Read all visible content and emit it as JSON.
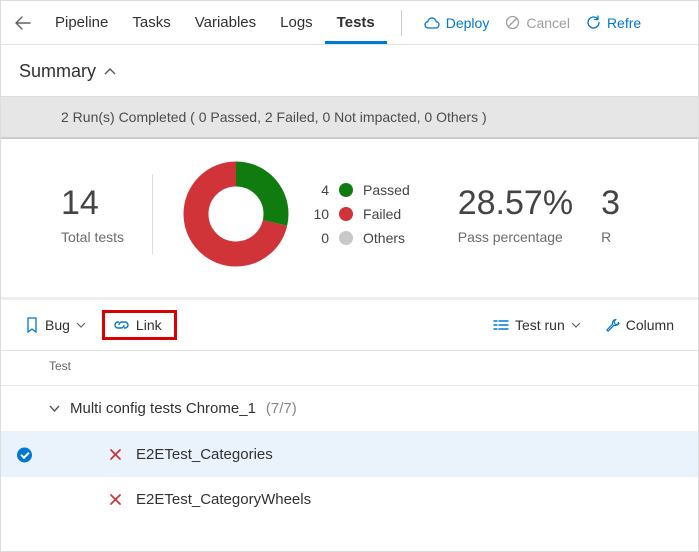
{
  "tabs": {
    "pipeline": "Pipeline",
    "tasks": "Tasks",
    "variables": "Variables",
    "logs": "Logs",
    "tests": "Tests"
  },
  "actions": {
    "deploy": "Deploy",
    "cancel": "Cancel",
    "refresh": "Refre"
  },
  "summary": {
    "title": "Summary",
    "runs_text": "2 Run(s) Completed ( 0 Passed, 2 Failed, 0 Not impacted, 0 Others )"
  },
  "chart_data": {
    "type": "pie",
    "title": "",
    "categories": [
      "Passed",
      "Failed",
      "Others"
    ],
    "values": [
      4,
      10,
      0
    ],
    "colors": [
      "#107c10",
      "#d13438",
      "#c8c8c8"
    ]
  },
  "stats": {
    "total_value": "14",
    "total_label": "Total tests",
    "legend": {
      "passed_n": "4",
      "passed_l": "Passed",
      "failed_n": "10",
      "failed_l": "Failed",
      "others_n": "0",
      "others_l": "Others"
    },
    "pass_pct_value": "28.57%",
    "pass_pct_label": "Pass percentage",
    "cutoff_value": "3",
    "cutoff_label": "R"
  },
  "toolbar": {
    "bug": "Bug",
    "link": "Link",
    "test_run": "Test run",
    "column": "Column"
  },
  "test_list": {
    "header": "Test",
    "group_name": "Multi config tests Chrome_1",
    "group_count": "(7/7)",
    "rows": [
      {
        "name": "E2ETest_Categories",
        "selected": true
      },
      {
        "name": "E2ETest_CategoryWheels",
        "selected": false
      }
    ]
  }
}
